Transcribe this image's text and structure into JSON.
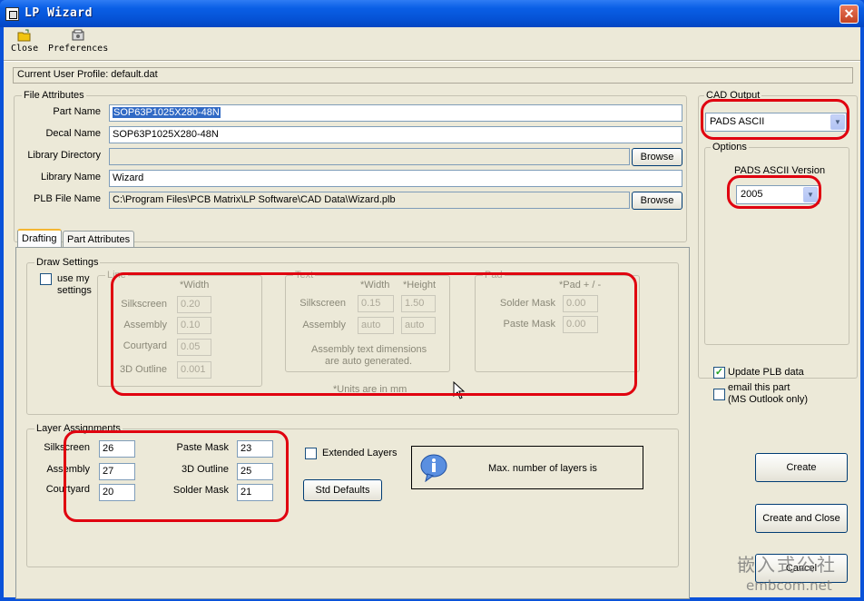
{
  "window": {
    "title": "LP Wizard"
  },
  "toolbar": {
    "close_label": "Close",
    "preferences_label": "Preferences"
  },
  "profile": {
    "text": "Current User Profile: default.dat"
  },
  "file_attributes": {
    "group_label": "File Attributes",
    "part_name_label": "Part Name",
    "part_name_value": "SOP63P1025X280-48N",
    "decal_name_label": "Decal Name",
    "decal_name_value": "SOP63P1025X280-48N",
    "library_directory_label": "Library Directory",
    "library_directory_value": "",
    "library_name_label": "Library Name",
    "library_name_value": "Wizard",
    "plb_file_label": "PLB File Name",
    "plb_file_value": "C:\\Program Files\\PCB Matrix\\LP Software\\CAD Data\\Wizard.plb",
    "browse_label": "Browse"
  },
  "cad_output": {
    "group_label": "CAD Output",
    "selected": "PADS ASCII",
    "options_label": "Options",
    "version_label": "PADS ASCII Version",
    "version_selected": "2005"
  },
  "tabs": [
    {
      "label": "Drafting",
      "active": true
    },
    {
      "label": "Part Attributes",
      "active": false
    }
  ],
  "draw_settings": {
    "group_label": "Draw Settings",
    "use_my_settings_line1": "use my",
    "use_my_settings_line2": "settings",
    "line": {
      "group_label": "Line",
      "width_header": "*Width",
      "rows": [
        {
          "label": "Silkscreen",
          "value": "0.20"
        },
        {
          "label": "Assembly",
          "value": "0.10"
        },
        {
          "label": "Courtyard",
          "value": "0.05"
        },
        {
          "label": "3D Outline",
          "value": "0.001"
        }
      ]
    },
    "text": {
      "group_label": "Text",
      "width_header": "*Width",
      "height_header": "*Height",
      "rows": [
        {
          "label": "Silkscreen",
          "width": "0.15",
          "height": "1.50"
        },
        {
          "label": "Assembly",
          "width": "auto",
          "height": "auto"
        }
      ],
      "note_line1": "Assembly text dimensions",
      "note_line2": "are auto generated."
    },
    "pad": {
      "group_label": "Pad",
      "header": "*Pad + / -",
      "rows": [
        {
          "label": "Solder Mask",
          "value": "0.00"
        },
        {
          "label": "Paste Mask",
          "value": "0.00"
        }
      ]
    },
    "units_note": "*Units are in mm"
  },
  "layer_assignments": {
    "group_label": "Layer Assignments",
    "silkscreen_label": "Silkscreen",
    "silkscreen_value": "26",
    "assembly_label": "Assembly",
    "assembly_value": "27",
    "courtyard_label": "Courtyard",
    "courtyard_value": "20",
    "paste_mask_label": "Paste Mask",
    "paste_mask_value": "23",
    "outline_3d_label": "3D Outline",
    "outline_3d_value": "25",
    "solder_mask_label": "Solder Mask",
    "solder_mask_value": "21",
    "extended_layers_label": "Extended Layers",
    "std_defaults_label": "Std Defaults",
    "info_text": "Max. number of layers is"
  },
  "right_panel": {
    "update_plb_label": "Update PLB data",
    "update_plb_checked": true,
    "email_line1": "email this part",
    "email_line2": "(MS Outlook only)",
    "create_label": "Create",
    "create_close_label": "Create and Close",
    "cancel_label": "Cancel"
  },
  "watermark": {
    "line1": "嵌入式公社",
    "line2": "embcom.net"
  },
  "colors": {
    "titlebar": "#0552d5",
    "window_bg": "#ece9d8",
    "highlight_ring": "#e0000f",
    "selection": "#316ac5"
  }
}
